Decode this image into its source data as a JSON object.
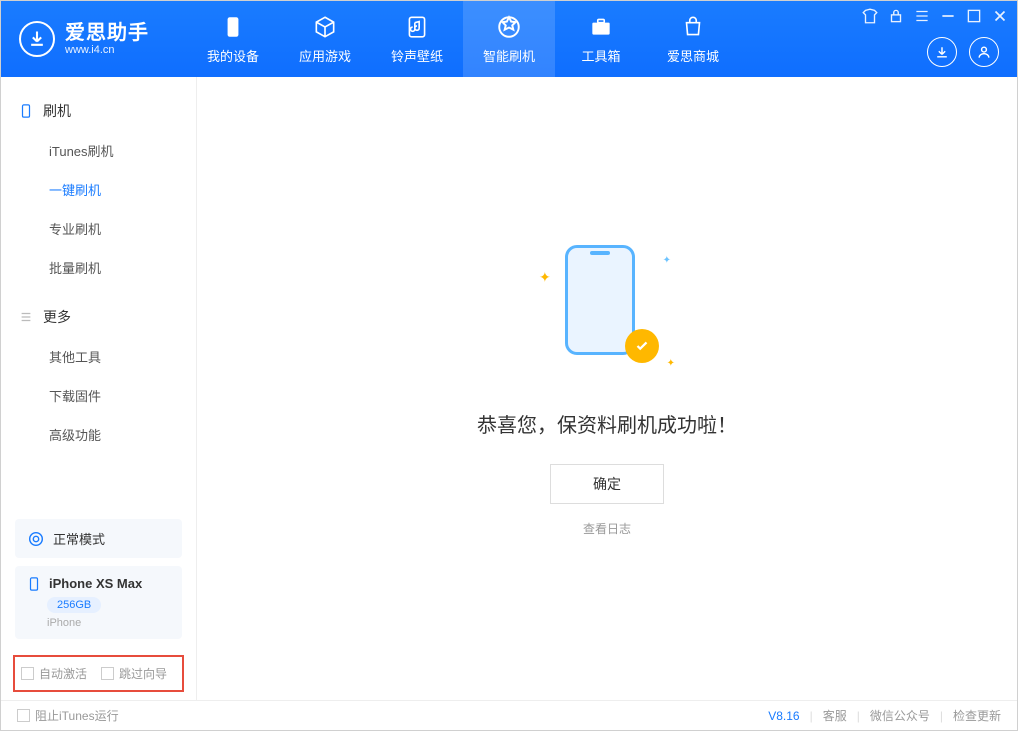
{
  "app": {
    "name_cn": "爱思助手",
    "name_en": "www.i4.cn"
  },
  "nav": {
    "device": "我的设备",
    "apps": "应用游戏",
    "ringtones": "铃声壁纸",
    "flash": "智能刷机",
    "toolbox": "工具箱",
    "store": "爱思商城"
  },
  "sidebar": {
    "section1": "刷机",
    "items1": [
      "iTunes刷机",
      "一键刷机",
      "专业刷机",
      "批量刷机"
    ],
    "section2": "更多",
    "items2": [
      "其他工具",
      "下载固件",
      "高级功能"
    ]
  },
  "device_status": {
    "mode": "正常模式"
  },
  "device_info": {
    "name": "iPhone XS Max",
    "capacity": "256GB",
    "type": "iPhone"
  },
  "checks": {
    "auto_activate": "自动激活",
    "skip_guide": "跳过向导"
  },
  "main": {
    "success_msg": "恭喜您，保资料刷机成功啦！",
    "confirm": "确定",
    "view_log": "查看日志"
  },
  "footer": {
    "block_itunes": "阻止iTunes运行",
    "version": "V8.16",
    "support": "客服",
    "wechat": "微信公众号",
    "update": "检查更新"
  }
}
